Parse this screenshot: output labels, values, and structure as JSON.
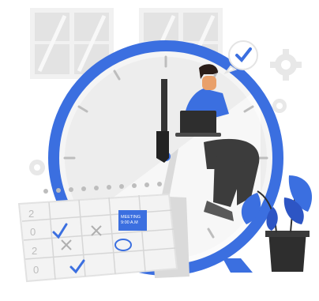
{
  "colors": {
    "accent": "#3B6FE0",
    "accent_dark": "#2D55C4",
    "clock_face": "#F4F4F4",
    "grey_light": "#E6E6E6",
    "grey_mid": "#D0D0D0",
    "grey_dark": "#3B3B3B",
    "pants": "#3C3C3C",
    "shirt": "#3B6FE0",
    "skin": "#E9A06A",
    "hair": "#2A1D18",
    "plant": "#3B6FE0",
    "pot": "#2E2E2E"
  },
  "calendar": {
    "note": "MEETING\n9:00 A.M",
    "year_digits": [
      "2",
      "0",
      "2",
      "0"
    ]
  },
  "icons": [
    "check-bubble-icon",
    "gear-icon",
    "laptop-icon",
    "plant-icon",
    "calendar-icon",
    "clock-icon"
  ]
}
